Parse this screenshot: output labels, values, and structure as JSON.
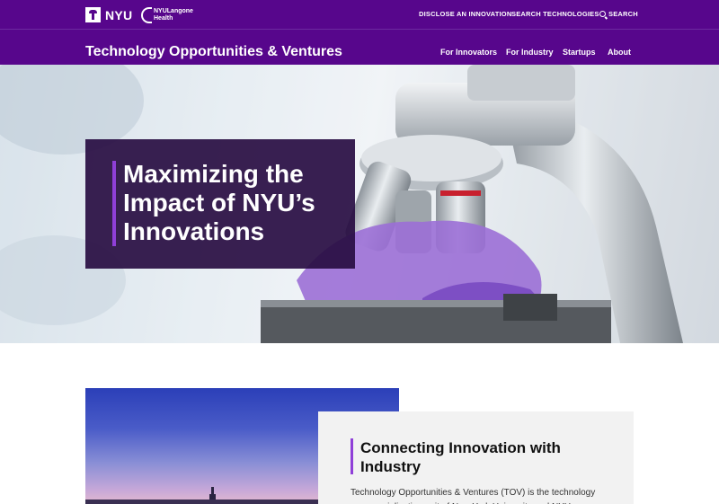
{
  "header": {
    "logo_text": "NYU",
    "langone_logo_line1": "NYULangone",
    "langone_logo_line2": "Health",
    "utility_nav": [
      "DISCLOSE AN INNOVATION",
      "SEARCH TECHNOLOGIES",
      "SEARCH"
    ],
    "site_title": "Technology Opportunities & Ventures",
    "main_nav": [
      "For Innovators",
      "For Industry",
      "Startups",
      "About"
    ]
  },
  "hero": {
    "title": "Maximizing the Impact of NYU’s Innovations"
  },
  "feature": {
    "title": "Connecting Innovation with Industry",
    "body": "Technology Opportunities & Ventures (TOV) is the technology commercialization unit of New York University and NYU Langone"
  },
  "colors": {
    "brand_purple": "#57068c",
    "accent_violet": "#8f3fd8",
    "hero_box": "#280d42"
  }
}
